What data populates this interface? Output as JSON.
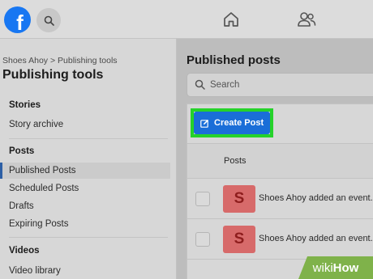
{
  "topbar": {
    "logo_letter": "f",
    "icons": [
      "search-icon",
      "home-icon",
      "friends-icon"
    ]
  },
  "sidebar": {
    "breadcrumb": "Shoes Ahoy > Publishing tools",
    "title": "Publishing tools",
    "sections": [
      {
        "label": "Stories",
        "items": [
          "Story archive"
        ]
      },
      {
        "label": "Posts",
        "items": [
          "Published Posts",
          "Scheduled Posts",
          "Drafts",
          "Expiring Posts"
        ]
      },
      {
        "label": "Videos",
        "items": [
          "Video library"
        ]
      }
    ],
    "active_item": "Published Posts"
  },
  "main": {
    "title": "Published posts",
    "search_placeholder": "Search",
    "create_button": "Create Post",
    "table_header": "Posts",
    "rows": [
      {
        "thumb_letter": "S",
        "text": "Shoes Ahoy added an event."
      },
      {
        "thumb_letter": "S",
        "text": "Shoes Ahoy added an event."
      }
    ]
  },
  "colors": {
    "brand": "#1877f2",
    "button": "#1a6ed8",
    "highlight": "#25d22a",
    "thumb": "#d76a6a",
    "watermark": "#7fb24a"
  },
  "watermark": {
    "prefix": "wiki",
    "suffix": "How"
  }
}
